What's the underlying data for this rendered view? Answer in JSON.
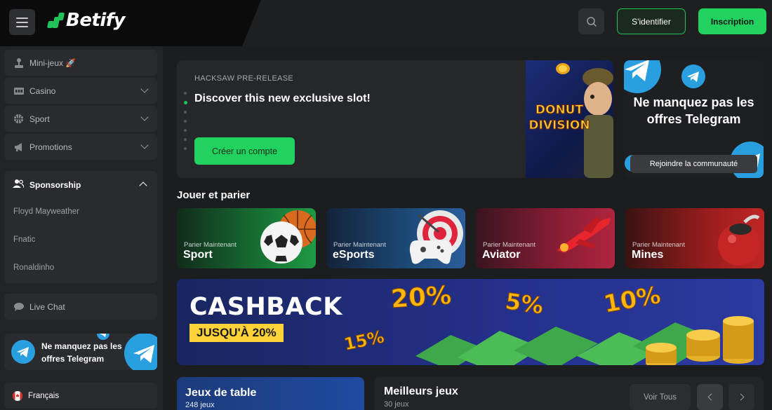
{
  "header": {
    "brand": "Betify",
    "login_label": "S'identifier",
    "signup_label": "Inscription"
  },
  "sidebar": {
    "items": [
      {
        "label": "Mini-jeux 🚀",
        "icon": "joystick-icon"
      },
      {
        "label": "Casino",
        "icon": "slot-machine-icon"
      },
      {
        "label": "Sport",
        "icon": "ball-icon"
      },
      {
        "label": "Promotions",
        "icon": "megaphone-icon"
      }
    ],
    "sponsorship": {
      "label": "Sponsorship",
      "subitems": [
        "Floyd Mayweather",
        "Fnatic",
        "Ronaldinho"
      ]
    },
    "live_chat": "Live Chat",
    "telegram_text": "Ne manquez pas les offres Telegram",
    "language": "Français"
  },
  "hero": {
    "kicker": "HACKSAW PRE-RELEASE",
    "title": "Discover this new exclusive slot!",
    "cta": "Créer un compte",
    "game_logo": "DONUT DIVISION"
  },
  "telegram_card": {
    "title": "Ne manquez pas les offres Telegram",
    "button": "Rejoindre la communauté"
  },
  "section": {
    "title": "Jouer et parier"
  },
  "games": [
    {
      "sub": "Parier Maintenant",
      "name": "Sport"
    },
    {
      "sub": "Parier Maintenant",
      "name": "eSports"
    },
    {
      "sub": "Parier Maintenant",
      "name": "Aviator"
    },
    {
      "sub": "Parier Maintenant",
      "name": "Mines"
    }
  ],
  "cashback": {
    "title": "CASHBACK",
    "tag": "JUSQU'À 20%",
    "percents": [
      "20%",
      "5%",
      "10%",
      "15%"
    ]
  },
  "table_games": {
    "title": "Jeux de table",
    "count": "248 jeux"
  },
  "best_games": {
    "title": "Meilleurs jeux",
    "count": "30 jeux",
    "see_all": "Voir Tous"
  },
  "colors": {
    "accent": "#21d35e",
    "background": "#1c1d1f",
    "telegram": "#2a9fe0"
  }
}
